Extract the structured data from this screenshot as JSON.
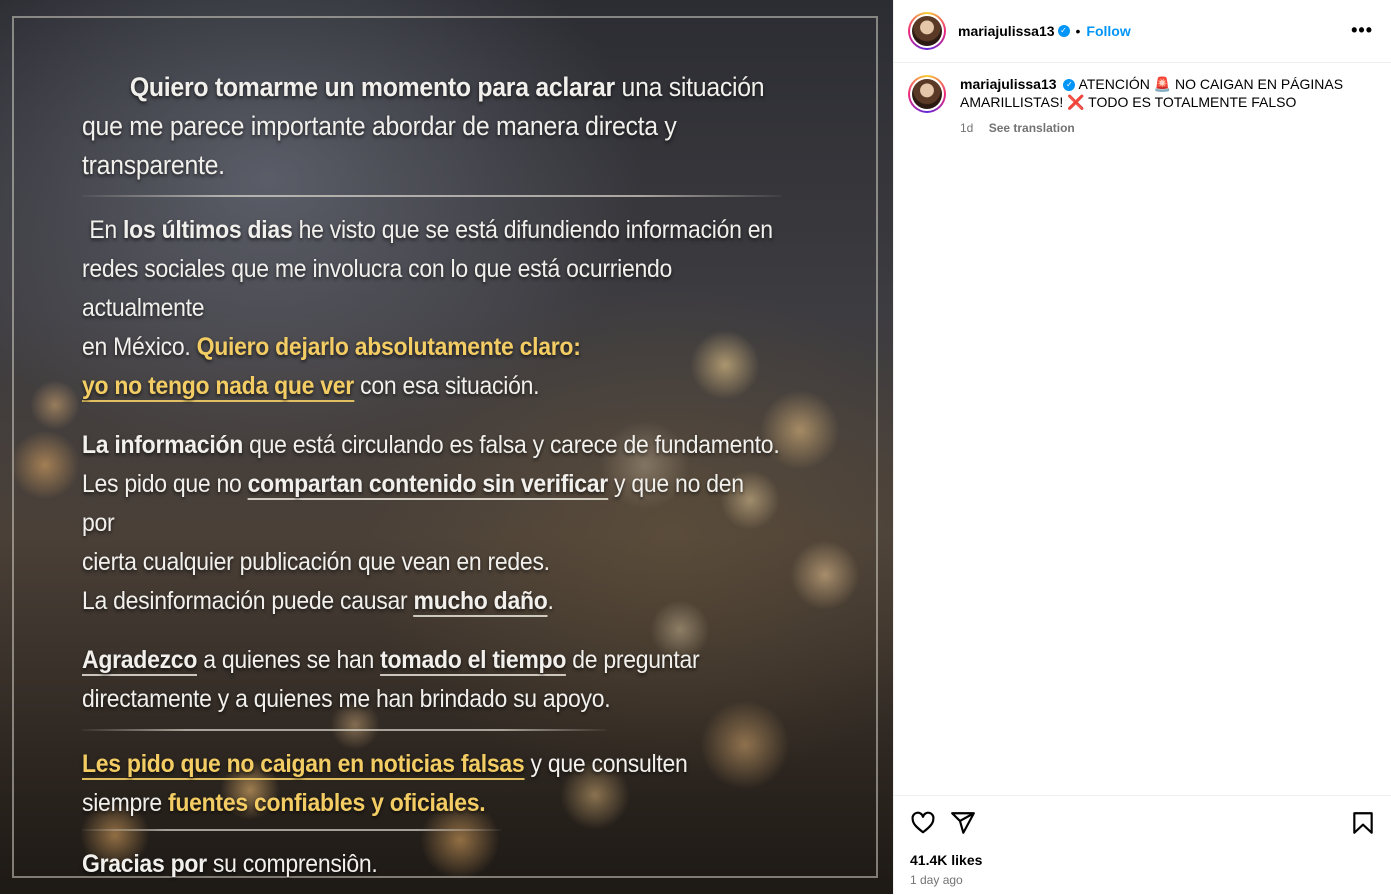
{
  "post": {
    "line1_bold": "Quiero tomarme un momento para aclarar",
    "line1_rest": " una situación",
    "line2": "que me parece importante abordar de manera directa y transparente.",
    "p2_a": "En ",
    "p2_b": "los últimos dias",
    "p2_c": " he visto que se está difundiendo información en",
    "p2_line2": "redes sociales que me involucra con lo que está ocurriendo actualmente",
    "p2_line3_a": "en México. ",
    "p2_line3_hl": "Quiero dejarlo absolutamente claro:",
    "p2_line4_hl": "yo no tengo nada que ver",
    "p2_line4_rest": " con esa situación.",
    "p3_a": "La información",
    "p3_b": " que está circulando es falsa y carece de fundamento.",
    "p3_line2_a": "Les pido que no ",
    "p3_line2_b": "compartan contenido sin verificar",
    "p3_line2_c": " y que no den por",
    "p3_line3": "cierta cualquier publicación que vean en redes.",
    "p3_line4_a": "La desinformación puede causar ",
    "p3_line4_b": "mucho daño",
    "p3_line4_c": ".",
    "p4_a": "Agradezco",
    "p4_b": " a quienes se han ",
    "p4_c": "tomado el tiempo",
    "p4_d": " de preguntar",
    "p4_line2": "directamente y a quienes me han brindado su apoyo.",
    "p5_hl": "Les pido que no caigan en noticias falsas",
    "p5_rest": " y que consulten",
    "p5_line2_a": "siempre ",
    "p5_line2_hl": "fuentes confiables y oficiales.",
    "p6_a": "Gracias",
    "p6_b": " por",
    "p6_c": " su comprensiôn."
  },
  "header": {
    "username": "mariajulissa13",
    "separator": "•",
    "follow_label": "Follow",
    "more_label": "•••"
  },
  "caption": {
    "username": "mariajulissa13",
    "text": "ATENCIÓN 🚨 NO CAIGAN EN PÁGINAS AMARILLISTAS! ❌ TODO ES TOTALMENTE FALSO",
    "age": "1d",
    "see_translation": "See translation"
  },
  "footer": {
    "likes": "41.4K likes",
    "time_ago": "1 day ago"
  },
  "icons": {
    "verified": "verified-badge-icon",
    "like": "heart-icon",
    "share": "send-icon",
    "save": "bookmark-icon"
  },
  "colors": {
    "accent": "#0095f6",
    "highlight_text": "#f3cd64",
    "muted": "#737373"
  }
}
